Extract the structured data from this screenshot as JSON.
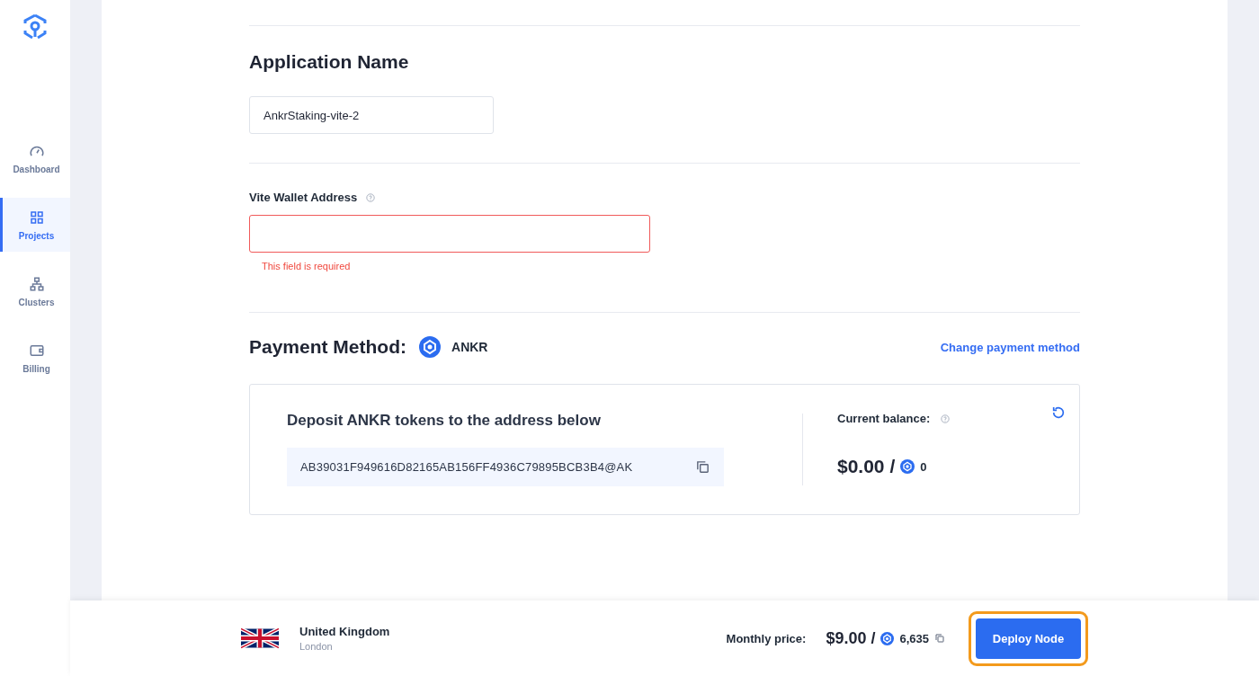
{
  "sidebar": {
    "items": [
      {
        "label": "Dashboard",
        "selected": false
      },
      {
        "label": "Projects",
        "selected": true
      },
      {
        "label": "Clusters",
        "selected": false
      },
      {
        "label": "Billing",
        "selected": false
      }
    ]
  },
  "app_name": {
    "title": "Application Name",
    "value": "AnkrStaking-vite-2"
  },
  "wallet": {
    "label": "Vite Wallet Address",
    "invalid": true,
    "error": "This field is required"
  },
  "payment": {
    "title": "Payment Method:",
    "token": "ANKR",
    "change_link": "Change payment method",
    "deposit_title": "Deposit ANKR tokens to the address below",
    "address": "AB39031F949616D82165AB156FF4936C79895BCB3B4@AK",
    "balance_label": "Current balance:",
    "balance_usd": "$0.00 /",
    "balance_tokens": "0"
  },
  "footer": {
    "country": "United Kingdom",
    "city": "London",
    "price_label": "Monthly price:",
    "price_usd": "$9.00 /",
    "price_tokens": "6,635",
    "button": "Deploy Node",
    "highlighted": true
  }
}
